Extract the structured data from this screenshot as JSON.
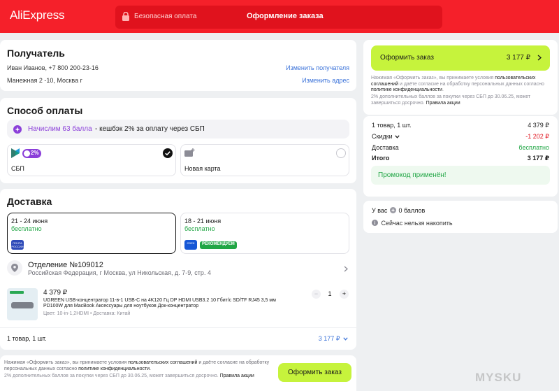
{
  "header": {
    "logo": "AliExpress",
    "secure_payment": "Безопасная оплата",
    "title": "Оформление заказа"
  },
  "recipient": {
    "heading": "Получатель",
    "name_phone": "Иван Иванов, +7 800 200-23-16",
    "change_recipient": "Изменить получателя",
    "address": "Манежная 2 -10, Москва г",
    "change_address": "Изменить адрес"
  },
  "payment": {
    "heading": "Способ оплаты",
    "bonus_accrual": "Начислим 63 балла",
    "bonus_rest": " - кешбэк 2% за оплату через СБП",
    "sbp_badge": "2%",
    "sbp_label": "СБП",
    "new_card_label": "Новая карта"
  },
  "delivery": {
    "heading": "Доставка",
    "options": [
      {
        "dates": "21 - 24 июня",
        "price": "бесплатно",
        "logo_text": "ПОЧТА РОССИИ",
        "selected": true
      },
      {
        "dates": "18 - 21 июня",
        "price": "бесплатно",
        "logo_text": "CDEK",
        "badge": "РЕКОМЕНДУЕМ",
        "selected": false
      }
    ],
    "pickup_title": "Отделение №109012",
    "pickup_address": "Российская Федерация, г Москва, ул Никольская, д. 7-9, стр. 4"
  },
  "product": {
    "price": "4 379 ₽",
    "title": "UGREEN USB-концентратор 11-в-1 USB-C на 4K120 Гц DP HDMI USB3.2 10 Гбит/с SD/TF RJ45 3,5 мм PD100W для MacBook Аксессуары для ноутбуков Док-концентратор",
    "meta": "Цвет: 10-in-1,2HDMI • Доставка: Китай",
    "quantity": "1",
    "minus": "−",
    "plus": "+"
  },
  "items_footer": {
    "count": "1 товар, 1 шт.",
    "total": "3 177 ₽"
  },
  "bottom_bar": {
    "notice_pre": "Нажимая «Оформить заказ», вы принимаете условия ",
    "notice_link1": "пользовательских соглашений",
    "notice_mid": " и даёте согласие на обработку персональных данных согласно ",
    "notice_link2": "политике конфиденциальности",
    "notice_end": ".",
    "points_note": "2% дополнительных баллов за покупки через СБП до 30.06.25, может завершиться досрочно. ",
    "points_link": "Правила акции",
    "button": "Оформить заказ"
  },
  "sidebar": {
    "button_label": "Оформить заказ",
    "button_total": "3 177 ₽",
    "notice_pre": "Нажимая «Оформить заказ», вы принимаете условия ",
    "notice_link1": "пользовательских соглашений",
    "notice_mid": " и даёте согласие на обработку персональных данных согласно ",
    "notice_link2": "политике конфиденциальности",
    "notice_end": ".",
    "points_note": "2% дополнительных баллов за покупки через СБП до 30.06.25, может завершиться досрочно. ",
    "points_link": "Правила акции",
    "summary": {
      "items_label": "1 товар, 1 шт.",
      "items_value": "4 379 ₽",
      "discount_label": "Скидки",
      "discount_value": "-1 202 ₽",
      "delivery_label": "Доставка",
      "delivery_value": "бесплатно",
      "total_label": "Итого",
      "total_value": "3 177 ₽"
    },
    "promo_applied": "Промокод применён!",
    "points_prefix": "У вас",
    "points_value": "0 баллов",
    "cannot_accrue": "Сейчас нельзя накопить"
  },
  "watermark": "MYSKU",
  "colors": {
    "header_red": "#f5202a",
    "accent_green": "#c6f33c",
    "link_blue": "#3a72d9",
    "bonus_purple": "#8b3fd9",
    "success_green": "#21a645"
  }
}
